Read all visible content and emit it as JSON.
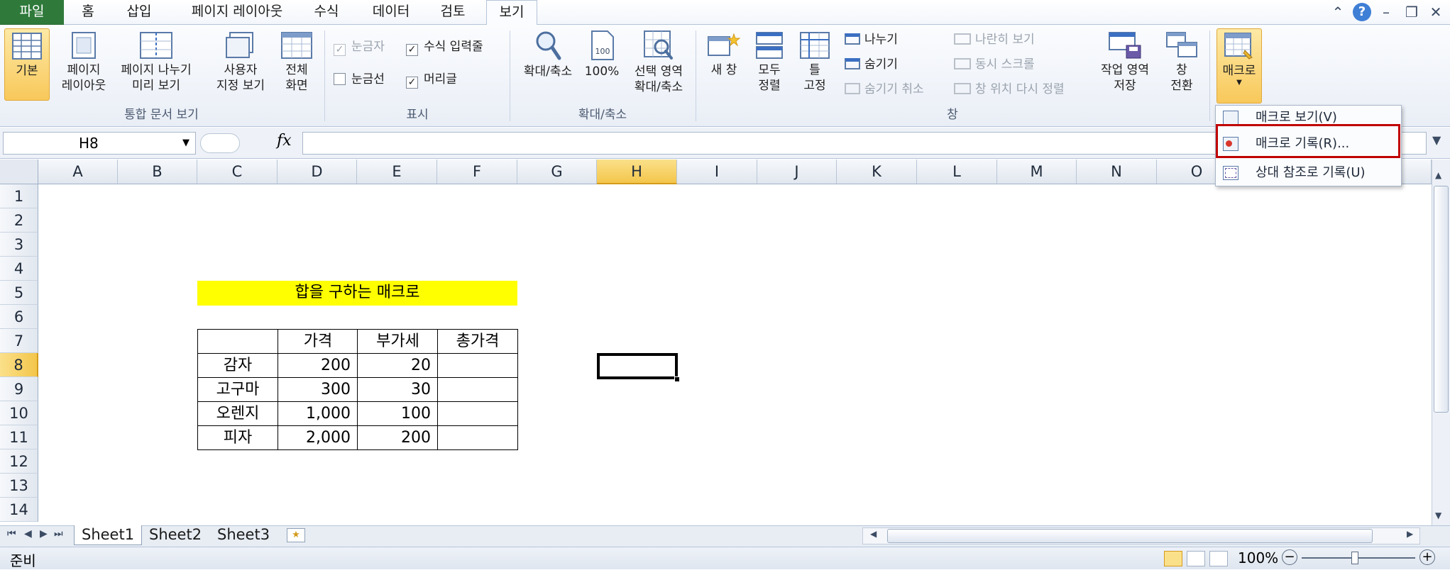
{
  "tabs": [
    {
      "id": "file",
      "label": "파일"
    },
    {
      "id": "home",
      "label": "홈"
    },
    {
      "id": "insert",
      "label": "삽입"
    },
    {
      "id": "pagelayout",
      "label": "페이지 레이아웃"
    },
    {
      "id": "formulas",
      "label": "수식"
    },
    {
      "id": "data",
      "label": "데이터"
    },
    {
      "id": "review",
      "label": "검토"
    },
    {
      "id": "view",
      "label": "보기"
    }
  ],
  "ribbon": {
    "workbook_views": {
      "label": "통합 문서 보기",
      "normal": "기본",
      "page_layout_1": "페이지",
      "page_layout_2": "레이아웃",
      "page_break_1": "페이지 나누기",
      "page_break_2": "미리 보기",
      "custom_1": "사용자",
      "custom_2": "지정 보기",
      "full_1": "전체",
      "full_2": "화면"
    },
    "show": {
      "label": "표시",
      "ruler": "눈금자",
      "formula_bar": "수식 입력줄",
      "gridlines": "눈금선",
      "headings": "머리글"
    },
    "zoom": {
      "label": "확대/축소",
      "zoom": "확대/축소",
      "hundred": "100%",
      "sel_1": "선택 영역",
      "sel_2": "확대/축소"
    },
    "window": {
      "label": "창",
      "new_window": "새 창",
      "arrange_1": "모두",
      "arrange_2": "정렬",
      "freeze_1": "틀",
      "freeze_2": "고정",
      "split": "나누기",
      "hide": "숨기기",
      "unhide": "숨기기 취소",
      "side_by_side": "나란히 보기",
      "sync_scroll": "동시 스크롤",
      "reset_pos": "창 위치 다시 정렬",
      "save_ws_1": "작업 영역",
      "save_ws_2": "저장",
      "switch_1": "창",
      "switch_2": "전환"
    },
    "macros": {
      "label": "매크로"
    }
  },
  "macro_menu": {
    "view": "매크로 보기(V)",
    "record": "매크로 기록(R)...",
    "relative": "상대 참조로 기록(U)"
  },
  "formula_bar": {
    "name_box": "H8",
    "fx": "fx",
    "value": ""
  },
  "columns": [
    "A",
    "B",
    "C",
    "D",
    "E",
    "F",
    "G",
    "H",
    "I",
    "J",
    "K",
    "L",
    "M",
    "N",
    "O"
  ],
  "rows": [
    "1",
    "2",
    "3",
    "4",
    "5",
    "6",
    "7",
    "8",
    "9",
    "10",
    "11",
    "12",
    "13",
    "14"
  ],
  "sheet": {
    "title": "합을 구하는 매크로",
    "header": [
      "",
      "가격",
      "부가세",
      "총가격"
    ],
    "data": [
      [
        "감자",
        "200",
        "20",
        ""
      ],
      [
        "고구마",
        "300",
        "30",
        ""
      ],
      [
        "오렌지",
        "1,000",
        "100",
        ""
      ],
      [
        "피자",
        "2,000",
        "200",
        ""
      ]
    ]
  },
  "sheet_tabs": [
    "Sheet1",
    "Sheet2",
    "Sheet3"
  ],
  "status": {
    "ready": "준비",
    "zoom": "100%"
  }
}
